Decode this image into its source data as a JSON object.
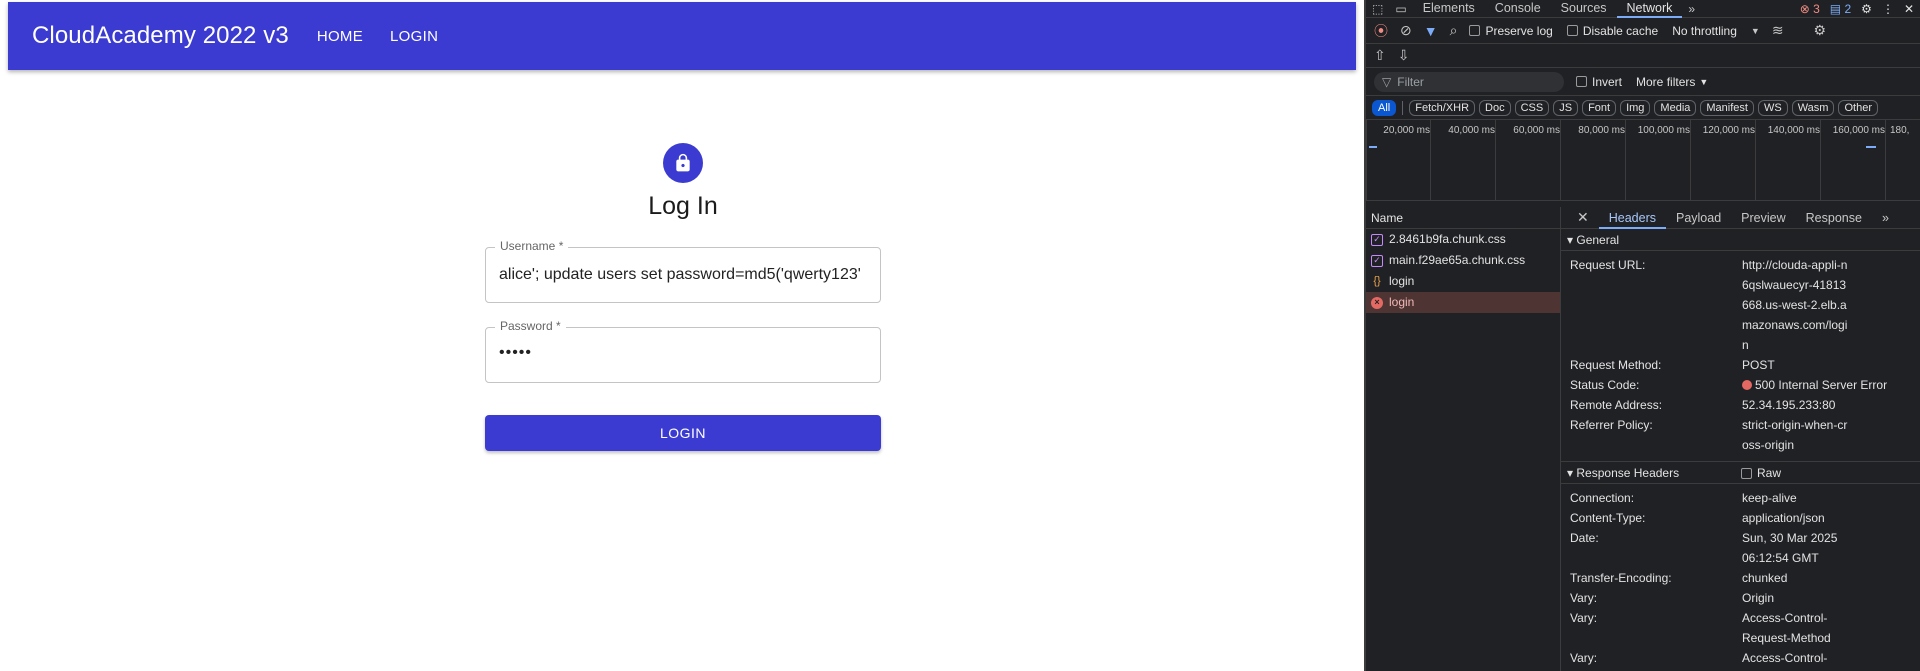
{
  "app": {
    "brand": "CloudAcademy 2022 v3",
    "nav": [
      "HOME",
      "LOGIN"
    ],
    "title": "Log In",
    "username_label": "Username *",
    "username_value": "alice'; update users set password=md5('qwerty123'",
    "password_label": "Password *",
    "password_value": "•••••",
    "login_button": "LOGIN",
    "accent_color": "#3b3bd1"
  },
  "devtools": {
    "tabs": [
      "Elements",
      "Console",
      "Sources",
      "Network"
    ],
    "active_tab": "Network",
    "error_count": "3",
    "message_count": "2",
    "toolbar": {
      "preserve_log": "Preserve log",
      "disable_cache": "Disable cache",
      "throttling": "No throttling"
    },
    "filter": {
      "placeholder": "Filter",
      "invert": "Invert",
      "more_filters": "More filters"
    },
    "types": [
      "All",
      "Fetch/XHR",
      "Doc",
      "CSS",
      "JS",
      "Font",
      "Img",
      "Media",
      "Manifest",
      "WS",
      "Wasm",
      "Other"
    ],
    "timeline_ticks": [
      "20,000 ms",
      "40,000 ms",
      "60,000 ms",
      "80,000 ms",
      "100,000 ms",
      "120,000 ms",
      "140,000 ms",
      "160,000 ms",
      "180,"
    ],
    "name_header": "Name",
    "requests": [
      {
        "name": "2.8461b9fa.chunk.css",
        "type": "css",
        "error": false
      },
      {
        "name": "main.f29ae65a.chunk.css",
        "type": "css",
        "error": false
      },
      {
        "name": "login",
        "type": "xhr",
        "error": false
      },
      {
        "name": "login",
        "type": "xhr",
        "error": true
      }
    ],
    "detail_tabs": [
      "Headers",
      "Payload",
      "Preview",
      "Response"
    ],
    "active_detail_tab": "Headers",
    "general_title": "General",
    "general": {
      "request_url_key": "Request URL:",
      "request_url": "http://clouda-appli-n6qslwauecyr-41813668.us-west-2.elb.amazonaws.com/login",
      "request_method_key": "Request Method:",
      "request_method": "POST",
      "status_code_key": "Status Code:",
      "status_code": "500 Internal Server Error",
      "remote_address_key": "Remote Address:",
      "remote_address": "52.34.195.233:80",
      "referrer_policy_key": "Referrer Policy:",
      "referrer_policy": "strict-origin-when-cross-origin"
    },
    "response_headers_title": "Response Headers",
    "raw_label": "Raw",
    "response_headers": [
      {
        "k": "Connection:",
        "v": "keep-alive"
      },
      {
        "k": "Content-Type:",
        "v": "application/json"
      },
      {
        "k": "Date:",
        "v": "Sun, 30 Mar 2025 06:12:54 GMT"
      },
      {
        "k": "Transfer-Encoding:",
        "v": "chunked"
      },
      {
        "k": "Vary:",
        "v": "Origin"
      },
      {
        "k": "Vary:",
        "v": "Access-Control-Request-Method"
      },
      {
        "k": "Vary:",
        "v": "Access-Control-Request-Headers"
      }
    ]
  }
}
